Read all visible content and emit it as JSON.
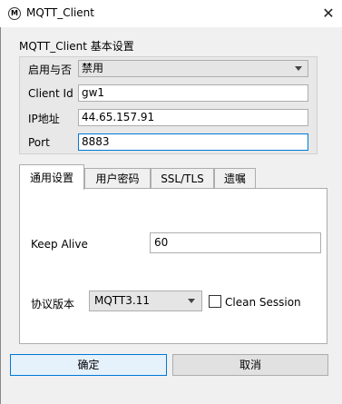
{
  "window": {
    "title": "MQTT_Client",
    "icon_letter": "M"
  },
  "group": {
    "title": "MQTT_Client 基本设置"
  },
  "fields": {
    "enable": {
      "label": "启用与否",
      "value": "禁用"
    },
    "client_id": {
      "label": "Client Id",
      "value": "gw1"
    },
    "ip": {
      "label": "IP地址",
      "value": "44.65.157.91"
    },
    "port": {
      "label": "Port",
      "value": "8883"
    }
  },
  "tabs": [
    "通用设置",
    "用户密码",
    "SSL/TLS",
    "遗嘱"
  ],
  "general": {
    "keep_alive_label": "Keep Alive",
    "keep_alive_value": "60",
    "protocol_label": "协议版本",
    "protocol_value": "MQTT3.11",
    "clean_session_label": "Clean Session",
    "clean_session_checked": false
  },
  "buttons": {
    "ok": "确定",
    "cancel": "取消"
  },
  "colors": {
    "focus": "#0078d7"
  }
}
